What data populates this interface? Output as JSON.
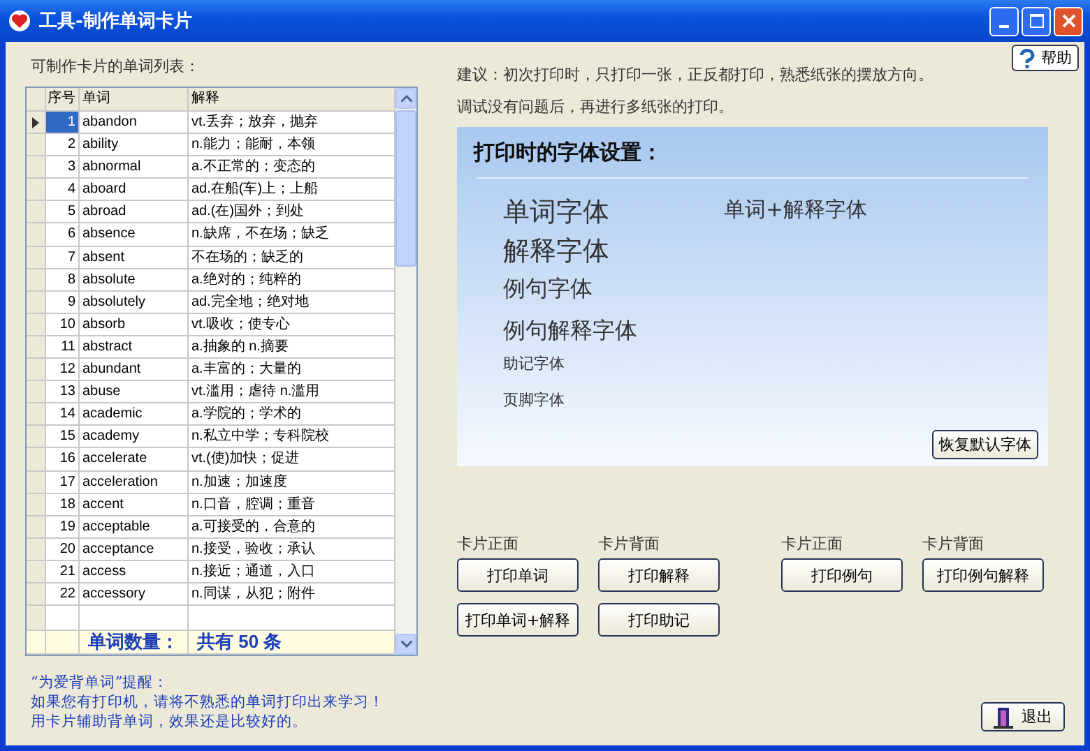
{
  "window": {
    "title": "工具-制作单词卡片"
  },
  "list_label": "可制作卡片的单词列表：",
  "table": {
    "columns": [
      "序号",
      "单词",
      "解释"
    ],
    "rows": [
      {
        "no": "1",
        "word": "abandon",
        "meaning": "vt.丢弃；放弃，抛弃",
        "selected": true
      },
      {
        "no": "2",
        "word": "ability",
        "meaning": "n.能力；能耐，本领",
        "selected": false
      },
      {
        "no": "3",
        "word": "abnormal",
        "meaning": "a.不正常的；变态的",
        "selected": false
      },
      {
        "no": "4",
        "word": "aboard",
        "meaning": "ad.在船(车)上；上船",
        "selected": false
      },
      {
        "no": "5",
        "word": "abroad",
        "meaning": "ad.(在)国外；到处",
        "selected": false
      },
      {
        "no": "6",
        "word": "absence",
        "meaning": "n.缺席，不在场；缺乏",
        "selected": false
      },
      {
        "no": "7",
        "word": "absent",
        "meaning": "不在场的；缺乏的",
        "selected": false
      },
      {
        "no": "8",
        "word": "absolute",
        "meaning": "a.绝对的；纯粹的",
        "selected": false
      },
      {
        "no": "9",
        "word": "absolutely",
        "meaning": "ad.完全地；绝对地",
        "selected": false
      },
      {
        "no": "10",
        "word": "absorb",
        "meaning": "vt.吸收；使专心",
        "selected": false
      },
      {
        "no": "11",
        "word": "abstract",
        "meaning": "a.抽象的 n.摘要",
        "selected": false
      },
      {
        "no": "12",
        "word": "abundant",
        "meaning": "a.丰富的；大量的",
        "selected": false
      },
      {
        "no": "13",
        "word": "abuse",
        "meaning": "vt.滥用；虐待 n.滥用",
        "selected": false
      },
      {
        "no": "14",
        "word": "academic",
        "meaning": "a.学院的；学术的",
        "selected": false
      },
      {
        "no": "15",
        "word": "academy",
        "meaning": "n.私立中学；专科院校",
        "selected": false
      },
      {
        "no": "16",
        "word": "accelerate",
        "meaning": "vt.(使)加快；促进",
        "selected": false
      },
      {
        "no": "17",
        "word": "acceleration",
        "meaning": "n.加速；加速度",
        "selected": false
      },
      {
        "no": "18",
        "word": "accent",
        "meaning": "n.口音，腔调；重音",
        "selected": false
      },
      {
        "no": "19",
        "word": "acceptable",
        "meaning": "a.可接受的，合意的",
        "selected": false
      },
      {
        "no": "20",
        "word": "acceptance",
        "meaning": "n.接受，验收；承认",
        "selected": false
      },
      {
        "no": "21",
        "word": "access",
        "meaning": "n.接近；通道，入口",
        "selected": false
      },
      {
        "no": "22",
        "word": "accessory",
        "meaning": "n.同谋，从犯；附件",
        "selected": false
      }
    ],
    "footer_label": "单词数量：",
    "footer_value": "共有  50  条"
  },
  "tip": {
    "title": "“为爱背单词”提醒：",
    "lines": [
      "如果您有打印机，请将不熟悉的单词打印出来学习！",
      "用卡片辅助背单词，效果还是比较好的。"
    ]
  },
  "help_button": "帮助",
  "advice": [
    "建议：初次打印时，只打印一张，正反都打印，熟悉纸张的摆放方向。",
    "调试没有问题后，再进行多纸张的打印。"
  ],
  "font_panel": {
    "title": "打印时的字体设置：",
    "word_font": "单词字体",
    "meaning_font": "解释字体",
    "word_meaning_font": "单词+解释字体",
    "example_font": "例句字体",
    "example_meaning_font": "例句解释字体",
    "mnemonic_font": "助记字体",
    "footer_font": "页脚字体",
    "reset_button": "恢复默认字体"
  },
  "print_groups": [
    {
      "label": "卡片正面",
      "buttons": [
        "打印单词",
        "打印单词+解释"
      ]
    },
    {
      "label": "卡片背面",
      "buttons": [
        "打印解释",
        "打印助记"
      ]
    },
    {
      "label": "卡片正面",
      "buttons": [
        "打印例句"
      ]
    },
    {
      "label": "卡片背面",
      "buttons": [
        "打印例句解释"
      ]
    }
  ],
  "exit_button": "退出"
}
